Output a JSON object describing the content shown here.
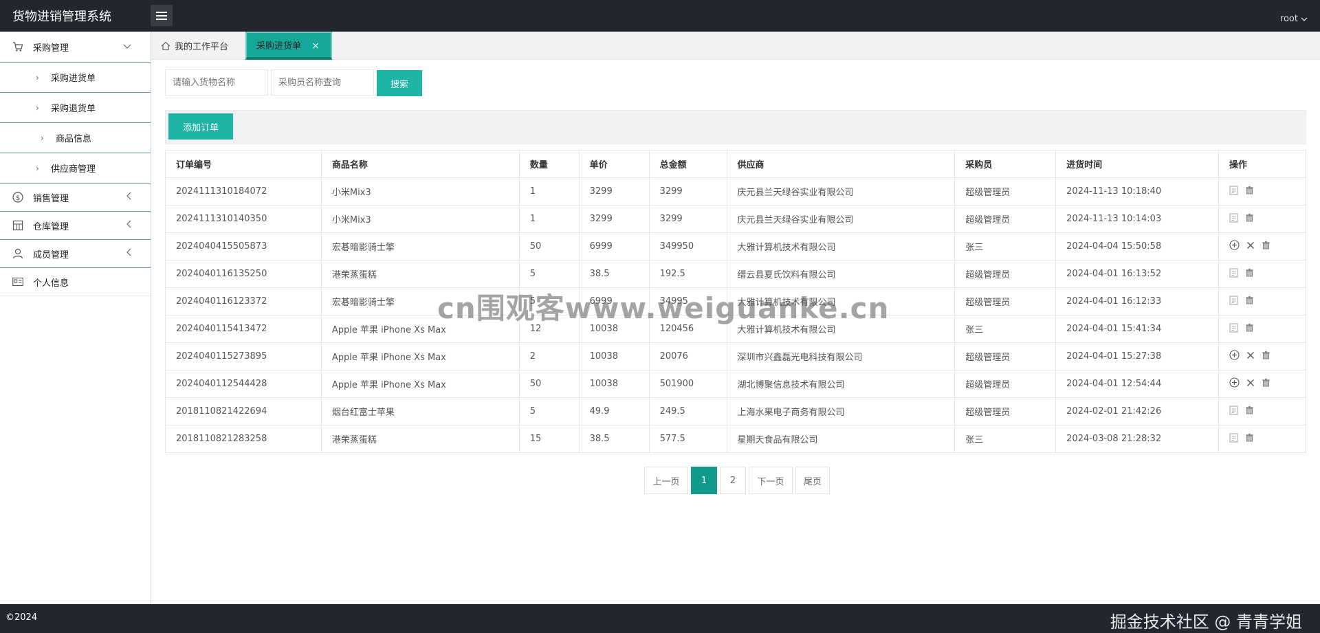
{
  "app": {
    "title": "货物进销管理系统",
    "user": "root"
  },
  "sidebar": {
    "purchase": {
      "label": "采购管理",
      "items": [
        "采购进货单",
        "采购退货单",
        "商品信息",
        "供应商管理"
      ]
    },
    "sales": {
      "label": "销售管理"
    },
    "warehouse": {
      "label": "仓库管理"
    },
    "members": {
      "label": "成员管理"
    },
    "profile": {
      "label": "个人信息"
    }
  },
  "tabs": {
    "home": "我的工作平台",
    "active": "采购进货单"
  },
  "search": {
    "goods_placeholder": "请输入货物名称",
    "buyer_placeholder": "采购员名称查询",
    "button": "搜索"
  },
  "toolbar": {
    "add_label": "添加订单"
  },
  "table": {
    "headers": [
      "订单编号",
      "商品名称",
      "数量",
      "单价",
      "总金额",
      "供应商",
      "采购员",
      "进货时间",
      "操作"
    ],
    "rows": [
      [
        "2024111310184072",
        "小米Mix3",
        "1",
        "3299",
        "3299",
        "庆元县兰天绿谷实业有限公司",
        "超级管理员",
        "2024-11-13 10:18:40"
      ],
      [
        "2024111310140350",
        "小米Mix3",
        "1",
        "3299",
        "3299",
        "庆元县兰天绿谷实业有限公司",
        "超级管理员",
        "2024-11-13 10:14:03"
      ],
      [
        "2024040415505873",
        "宏碁暗影骑士擎",
        "50",
        "6999",
        "349950",
        "大雅计算机技术有限公司",
        "张三",
        "2024-04-04 15:50:58"
      ],
      [
        "2024040116135250",
        "港荣蒸蛋糕",
        "5",
        "38.5",
        "192.5",
        "缙云县夏氏饮料有限公司",
        "超级管理员",
        "2024-04-01 16:13:52"
      ],
      [
        "2024040116123372",
        "宏碁暗影骑士擎",
        "5",
        "6999",
        "34995",
        "大雅计算机技术有限公司",
        "超级管理员",
        "2024-04-01 16:12:33"
      ],
      [
        "2024040115413472",
        "Apple 苹果 iPhone Xs Max",
        "12",
        "10038",
        "120456",
        "大雅计算机技术有限公司",
        "张三",
        "2024-04-01 15:41:34"
      ],
      [
        "2024040115273895",
        "Apple 苹果 iPhone Xs Max",
        "2",
        "10038",
        "20076",
        "深圳市兴鑫磊光电科技有限公司",
        "超级管理员",
        "2024-04-01 15:27:38"
      ],
      [
        "2024040112544428",
        "Apple 苹果 iPhone Xs Max",
        "50",
        "10038",
        "501900",
        "湖北博聚信息技术有限公司",
        "超级管理员",
        "2024-04-01 12:54:44"
      ],
      [
        "2018110821422694",
        "烟台红富士苹果",
        "5",
        "49.9",
        "249.5",
        "上海水果电子商务有限公司",
        "超级管理员",
        "2024-02-01 21:42:26"
      ],
      [
        "2018110821283258",
        "港荣蒸蛋糕",
        "15",
        "38.5",
        "577.5",
        "星期天食品有限公司",
        "张三",
        "2024-03-08 21:28:32"
      ]
    ],
    "row_actions": [
      [
        "edit-icon",
        "delete-icon"
      ],
      [
        "edit-icon",
        "delete-icon"
      ],
      [
        "add-circle-icon",
        "close-icon",
        "delete-icon"
      ],
      [
        "edit-icon",
        "delete-icon"
      ],
      [
        "edit-icon",
        "delete-icon"
      ],
      [
        "edit-icon",
        "delete-icon"
      ],
      [
        "add-circle-icon",
        "close-icon",
        "delete-icon"
      ],
      [
        "add-circle-icon",
        "close-icon",
        "delete-icon"
      ],
      [
        "edit-icon",
        "delete-icon"
      ],
      [
        "edit-icon",
        "delete-icon"
      ]
    ]
  },
  "pagination": {
    "prev": "上一页",
    "pages": [
      "1",
      "2"
    ],
    "current": "1",
    "next": "下一页",
    "last": "尾页"
  },
  "footer": {
    "copyright": "©2024",
    "credit": "掘金技术社区 @ 青青学姐"
  },
  "watermark": "cn围观客www.weiguanke.cn",
  "colors": {
    "accent": "#1fb5a6",
    "header_bg": "#23262e",
    "active_page": "#0f9a8c"
  }
}
